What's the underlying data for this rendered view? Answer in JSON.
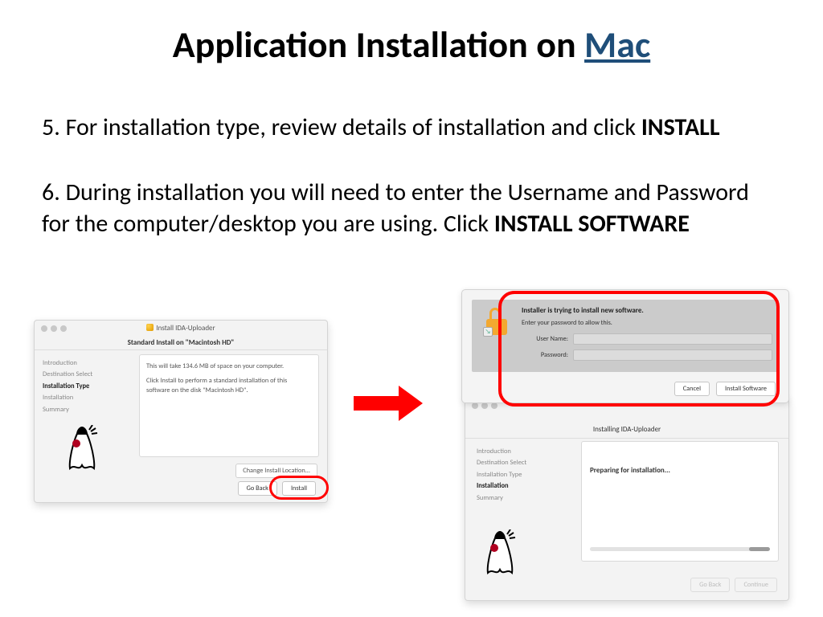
{
  "title": {
    "line": "Application Installation on ",
    "link": "Mac"
  },
  "steps": {
    "s5_num": "5.",
    "s5_text": "  For installation type, review details of installation and click ",
    "s5_bold": "INSTALL",
    "s6_num": "6.",
    "s6_text": "  During installation you will need to enter the Username and Password for the computer/desktop you are using. Click ",
    "s6_bold": "INSTALL SOFTWARE"
  },
  "installer_left": {
    "win_title": "Install IDA-Uploader",
    "sub_title": "Standard Install on \"Macintosh HD\"",
    "sidebar": [
      "Introduction",
      "Destination Select",
      "Installation Type",
      "Installation",
      "Summary"
    ],
    "sidebar_active_index": 2,
    "body_line1": "This will take 134.6 MB of space on your computer.",
    "body_line2": "Click Install to perform a standard installation of this software on the disk \"Macintosh HD\".",
    "change_location": "Change Install Location...",
    "go_back": "Go Back",
    "install": "Install"
  },
  "auth_dialog": {
    "msg1": "Installer is trying to install new software.",
    "msg2": "Enter your password to allow this.",
    "username_label": "User Name:",
    "password_label": "Password:",
    "cancel": "Cancel",
    "install_software": "Install Software"
  },
  "installer_right": {
    "sub_title": "Installing IDA-Uploader",
    "sidebar": [
      "Introduction",
      "Destination Select",
      "Installation Type",
      "Installation",
      "Summary"
    ],
    "sidebar_active_index": 3,
    "preparing": "Preparing for installation...",
    "go_back": "Go Back",
    "continue": "Continue"
  }
}
